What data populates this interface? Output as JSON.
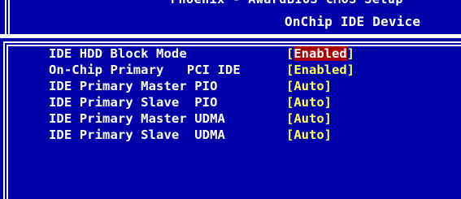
{
  "header": {
    "cut_text": "Phoenix - AwardBIOS CMOS Setup",
    "title": "OnChip IDE Device"
  },
  "settings": [
    {
      "label": "IDE HDD Block Mode",
      "value": "Enabled",
      "selected": true
    },
    {
      "label": "On-Chip Primary   PCI IDE",
      "value": "Enabled",
      "selected": false
    },
    {
      "label": "IDE Primary Master PIO",
      "value": "Auto",
      "selected": false
    },
    {
      "label": "IDE Primary Slave  PIO",
      "value": "Auto",
      "selected": false
    },
    {
      "label": "IDE Primary Master UDMA",
      "value": "Auto",
      "selected": false
    },
    {
      "label": "IDE Primary Slave  UDMA",
      "value": "Auto",
      "selected": false
    }
  ],
  "colors": {
    "background": "#0000a8",
    "label": "#ffffff",
    "value": "#ffff54",
    "selected_bg": "#a80000",
    "selected_fg": "#ffffff"
  }
}
